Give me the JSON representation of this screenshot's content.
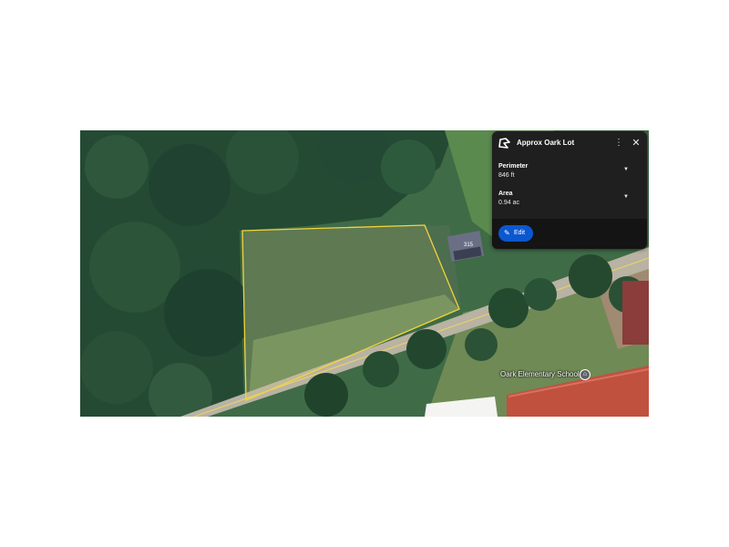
{
  "panel": {
    "title": "Approx Oark Lot",
    "icon": "measure-polygon-icon",
    "more_icon": "⋮",
    "close_icon": "✕",
    "perimeter": {
      "label": "Perimeter",
      "value": "846 ft"
    },
    "area": {
      "label": "Area",
      "value": "0.94 ac"
    },
    "edit_label": "Edit",
    "accent_color": "#0b57d0"
  },
  "map": {
    "house_number": "315",
    "school_label": "Oark Elementary School",
    "polygon_color": "#f2d43c"
  }
}
